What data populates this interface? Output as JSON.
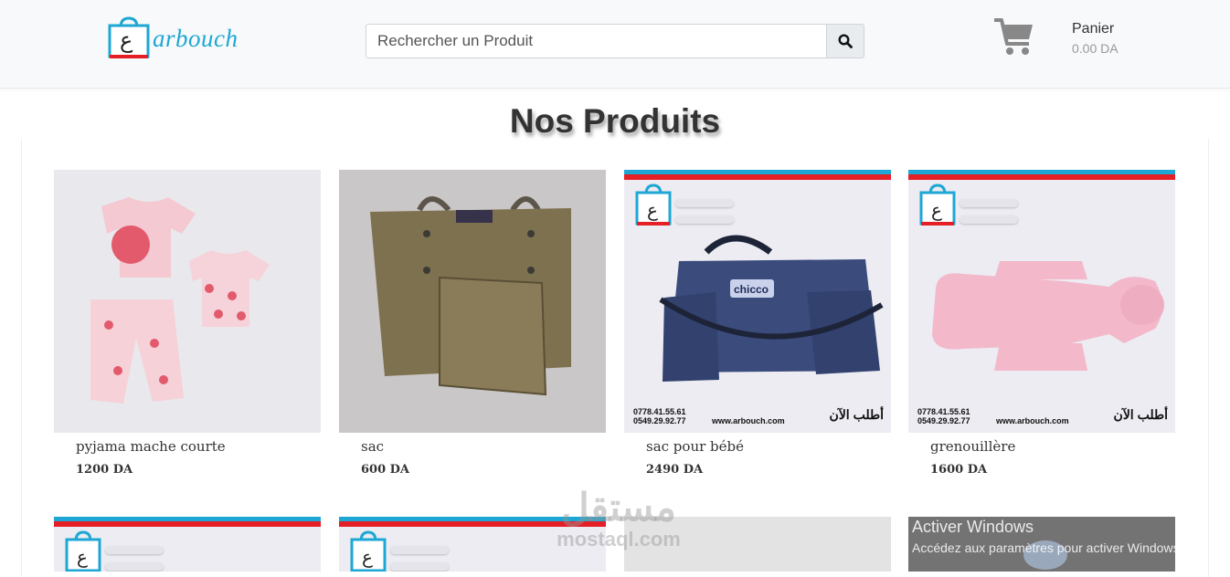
{
  "header": {
    "logo_text": "arbouch",
    "logo_letter": "ع",
    "search_placeholder": "Rechercher un Produit",
    "cart_label": "Panier",
    "cart_total": "0.00 DA"
  },
  "section": {
    "title": "Nos Produits"
  },
  "products": [
    {
      "name": "pyjama mache courte",
      "price": "1200 DA"
    },
    {
      "name": "sac",
      "price": "600 DA"
    },
    {
      "name": "sac pour bébé",
      "price": "2490 DA"
    },
    {
      "name": "grenouillère",
      "price": "1600 DA"
    }
  ],
  "ad": {
    "phone1": "0778.41.55.61",
    "phone2": "0549.29.92.77",
    "website": "www.arbouch.com",
    "cta": "أطلب الآن",
    "brand_on_bag": "chicco"
  },
  "watermark": {
    "arabic": "مستقل",
    "latin": "mostaql.com"
  },
  "windows": {
    "title": "Activer Windows",
    "subtitle": "Accédez aux paramètres pour activer Windows."
  },
  "colors": {
    "brand_blue": "#1ea7d4",
    "brand_red": "#e41f26",
    "cart_gray": "#888888"
  },
  "icons": {
    "search": "magnifier",
    "cart": "shopping-cart",
    "logo": "shopping-bag"
  }
}
